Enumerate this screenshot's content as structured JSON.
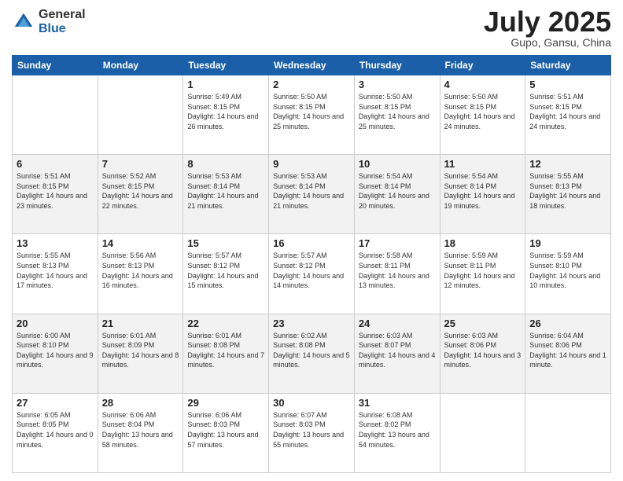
{
  "logo": {
    "general": "General",
    "blue": "Blue"
  },
  "header": {
    "month": "July 2025",
    "location": "Gupo, Gansu, China"
  },
  "weekdays": [
    "Sunday",
    "Monday",
    "Tuesday",
    "Wednesday",
    "Thursday",
    "Friday",
    "Saturday"
  ],
  "weeks": [
    [
      {
        "day": "",
        "info": ""
      },
      {
        "day": "",
        "info": ""
      },
      {
        "day": "1",
        "info": "Sunrise: 5:49 AM\nSunset: 8:15 PM\nDaylight: 14 hours and 26 minutes."
      },
      {
        "day": "2",
        "info": "Sunrise: 5:50 AM\nSunset: 8:15 PM\nDaylight: 14 hours and 25 minutes."
      },
      {
        "day": "3",
        "info": "Sunrise: 5:50 AM\nSunset: 8:15 PM\nDaylight: 14 hours and 25 minutes."
      },
      {
        "day": "4",
        "info": "Sunrise: 5:50 AM\nSunset: 8:15 PM\nDaylight: 14 hours and 24 minutes."
      },
      {
        "day": "5",
        "info": "Sunrise: 5:51 AM\nSunset: 8:15 PM\nDaylight: 14 hours and 24 minutes."
      }
    ],
    [
      {
        "day": "6",
        "info": "Sunrise: 5:51 AM\nSunset: 8:15 PM\nDaylight: 14 hours and 23 minutes."
      },
      {
        "day": "7",
        "info": "Sunrise: 5:52 AM\nSunset: 8:15 PM\nDaylight: 14 hours and 22 minutes."
      },
      {
        "day": "8",
        "info": "Sunrise: 5:53 AM\nSunset: 8:14 PM\nDaylight: 14 hours and 21 minutes."
      },
      {
        "day": "9",
        "info": "Sunrise: 5:53 AM\nSunset: 8:14 PM\nDaylight: 14 hours and 21 minutes."
      },
      {
        "day": "10",
        "info": "Sunrise: 5:54 AM\nSunset: 8:14 PM\nDaylight: 14 hours and 20 minutes."
      },
      {
        "day": "11",
        "info": "Sunrise: 5:54 AM\nSunset: 8:14 PM\nDaylight: 14 hours and 19 minutes."
      },
      {
        "day": "12",
        "info": "Sunrise: 5:55 AM\nSunset: 8:13 PM\nDaylight: 14 hours and 18 minutes."
      }
    ],
    [
      {
        "day": "13",
        "info": "Sunrise: 5:55 AM\nSunset: 8:13 PM\nDaylight: 14 hours and 17 minutes."
      },
      {
        "day": "14",
        "info": "Sunrise: 5:56 AM\nSunset: 8:13 PM\nDaylight: 14 hours and 16 minutes."
      },
      {
        "day": "15",
        "info": "Sunrise: 5:57 AM\nSunset: 8:12 PM\nDaylight: 14 hours and 15 minutes."
      },
      {
        "day": "16",
        "info": "Sunrise: 5:57 AM\nSunset: 8:12 PM\nDaylight: 14 hours and 14 minutes."
      },
      {
        "day": "17",
        "info": "Sunrise: 5:58 AM\nSunset: 8:11 PM\nDaylight: 14 hours and 13 minutes."
      },
      {
        "day": "18",
        "info": "Sunrise: 5:59 AM\nSunset: 8:11 PM\nDaylight: 14 hours and 12 minutes."
      },
      {
        "day": "19",
        "info": "Sunrise: 5:59 AM\nSunset: 8:10 PM\nDaylight: 14 hours and 10 minutes."
      }
    ],
    [
      {
        "day": "20",
        "info": "Sunrise: 6:00 AM\nSunset: 8:10 PM\nDaylight: 14 hours and 9 minutes."
      },
      {
        "day": "21",
        "info": "Sunrise: 6:01 AM\nSunset: 8:09 PM\nDaylight: 14 hours and 8 minutes."
      },
      {
        "day": "22",
        "info": "Sunrise: 6:01 AM\nSunset: 8:08 PM\nDaylight: 14 hours and 7 minutes."
      },
      {
        "day": "23",
        "info": "Sunrise: 6:02 AM\nSunset: 8:08 PM\nDaylight: 14 hours and 5 minutes."
      },
      {
        "day": "24",
        "info": "Sunrise: 6:03 AM\nSunset: 8:07 PM\nDaylight: 14 hours and 4 minutes."
      },
      {
        "day": "25",
        "info": "Sunrise: 6:03 AM\nSunset: 8:06 PM\nDaylight: 14 hours and 3 minutes."
      },
      {
        "day": "26",
        "info": "Sunrise: 6:04 AM\nSunset: 8:06 PM\nDaylight: 14 hours and 1 minute."
      }
    ],
    [
      {
        "day": "27",
        "info": "Sunrise: 6:05 AM\nSunset: 8:05 PM\nDaylight: 14 hours and 0 minutes."
      },
      {
        "day": "28",
        "info": "Sunrise: 6:06 AM\nSunset: 8:04 PM\nDaylight: 13 hours and 58 minutes."
      },
      {
        "day": "29",
        "info": "Sunrise: 6:06 AM\nSunset: 8:03 PM\nDaylight: 13 hours and 57 minutes."
      },
      {
        "day": "30",
        "info": "Sunrise: 6:07 AM\nSunset: 8:03 PM\nDaylight: 13 hours and 55 minutes."
      },
      {
        "day": "31",
        "info": "Sunrise: 6:08 AM\nSunset: 8:02 PM\nDaylight: 13 hours and 54 minutes."
      },
      {
        "day": "",
        "info": ""
      },
      {
        "day": "",
        "info": ""
      }
    ]
  ]
}
